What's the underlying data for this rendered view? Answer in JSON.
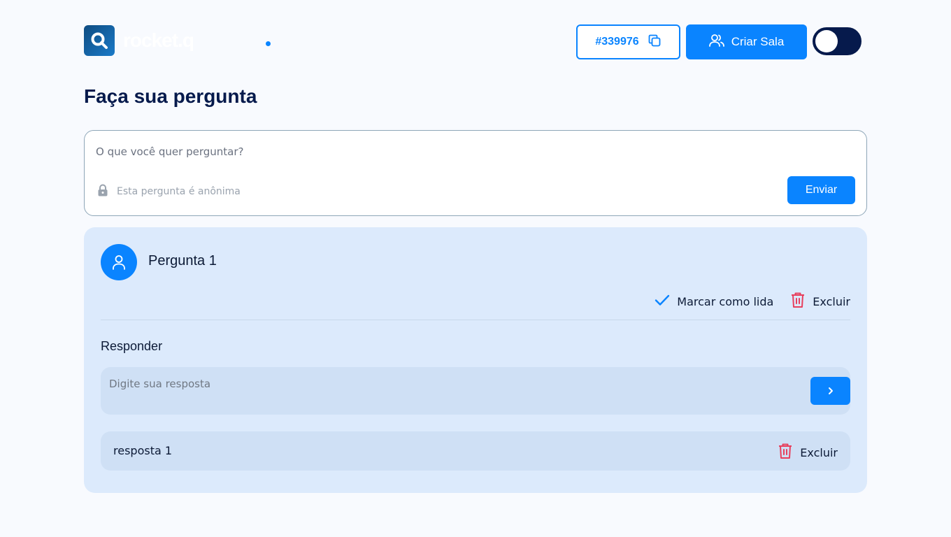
{
  "header": {
    "logo_text": "rocket.q",
    "room_code": "#339976",
    "create_room_label": "Criar Sala"
  },
  "page": {
    "title": "Faça sua pergunta"
  },
  "ask": {
    "placeholder": "O que você quer perguntar?",
    "anonymous_note": "Esta pergunta é anônima",
    "send_label": "Enviar"
  },
  "question": {
    "title": "Pergunta 1",
    "mark_read_label": "Marcar como lida",
    "delete_label": "Excluir",
    "reply_label": "Responder",
    "reply_placeholder": "Digite sua resposta",
    "answers": [
      {
        "text": "resposta 1",
        "delete_label": "Excluir"
      }
    ]
  },
  "colors": {
    "primary": "#0a84ff",
    "danger": "#e73f5d",
    "dark": "#061a4c",
    "card": "#dceafc"
  }
}
